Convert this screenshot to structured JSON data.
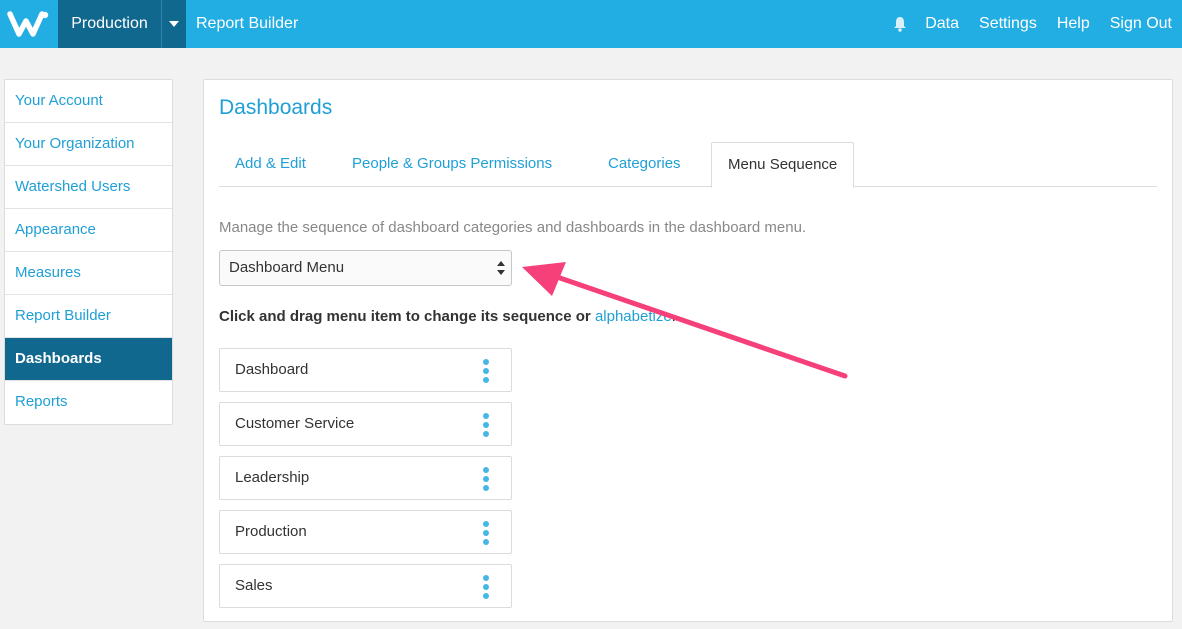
{
  "topbar": {
    "logo_icon": "watershed-w-logo",
    "environment": "Production",
    "report_builder": "Report Builder",
    "bell_icon": "bell-icon",
    "links": [
      "Data",
      "Settings",
      "Help",
      "Sign Out"
    ],
    "color": "#22ade3",
    "dark_color": "#11688f"
  },
  "sidebar": {
    "items": [
      {
        "label": "Your Account"
      },
      {
        "label": "Your Organization"
      },
      {
        "label": "Watershed Users"
      },
      {
        "label": "Appearance"
      },
      {
        "label": "Measures"
      },
      {
        "label": "Report Builder"
      },
      {
        "label": "Dashboards",
        "active": true
      },
      {
        "label": "Reports"
      }
    ]
  },
  "main": {
    "title": "Dashboards",
    "tabs": [
      {
        "label": "Add & Edit"
      },
      {
        "label": "People & Groups Permissions"
      },
      {
        "label": "Categories"
      },
      {
        "label": "Menu Sequence",
        "active": true
      }
    ],
    "description": "Manage the sequence of dashboard categories and dashboards in the dashboard menu.",
    "select_value": "Dashboard Menu",
    "instruction": "Click and drag menu item to change its sequence or",
    "alphabetize_link": "alphabetize",
    "instruction_end": ".",
    "menu_items": [
      {
        "label": "Dashboard"
      },
      {
        "label": "Customer Service"
      },
      {
        "label": "Leadership"
      },
      {
        "label": "Production"
      },
      {
        "label": "Sales"
      }
    ]
  },
  "annotation": {
    "arrow_color": "#f5407a"
  }
}
